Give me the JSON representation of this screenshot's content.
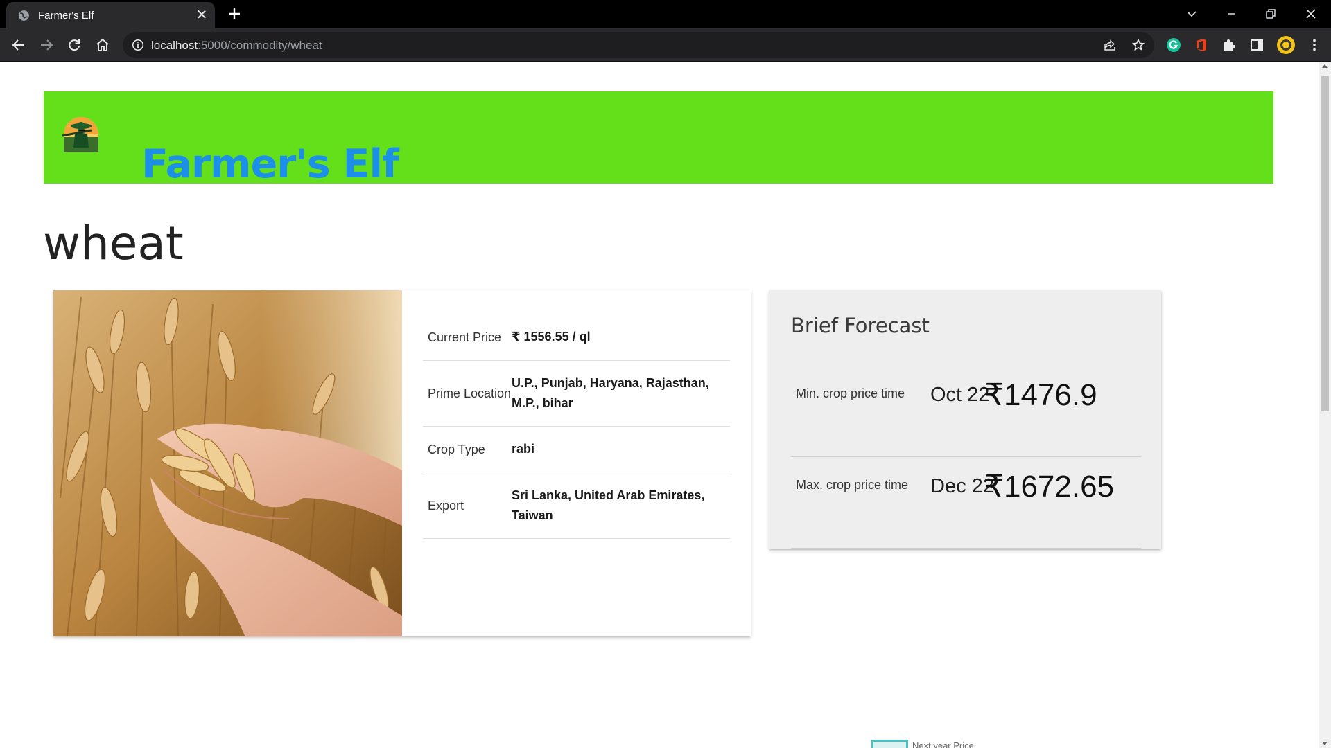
{
  "browser": {
    "tab_title": "Farmer's Elf",
    "url_host": "localhost",
    "url_path": ":5000/commodity/wheat"
  },
  "site": {
    "brand": "Farmer's Elf"
  },
  "commodity": {
    "name": "wheat",
    "details": [
      {
        "label": "Current Price",
        "value": "₹ 1556.55 / ql"
      },
      {
        "label": "Prime Location",
        "value": "U.P., Punjab, Haryana, Rajasthan, M.P., bihar"
      },
      {
        "label": "Crop Type",
        "value": "rabi"
      },
      {
        "label": "Export",
        "value": "Sri Lanka, United Arab Emirates, Taiwan"
      }
    ]
  },
  "forecast": {
    "title": "Brief Forecast",
    "rows": [
      {
        "label": "Min. crop price time",
        "date": "Oct 22",
        "price": "₹1476.9"
      },
      {
        "label": "Max. crop price time",
        "date": "Dec 22",
        "price": "₹1672.65"
      }
    ]
  },
  "chart_legend": {
    "label": "Next year Price",
    "color": "#4bc0c0"
  },
  "colors": {
    "banner": "#64e01a",
    "brand_text": "#1c8fe8"
  }
}
